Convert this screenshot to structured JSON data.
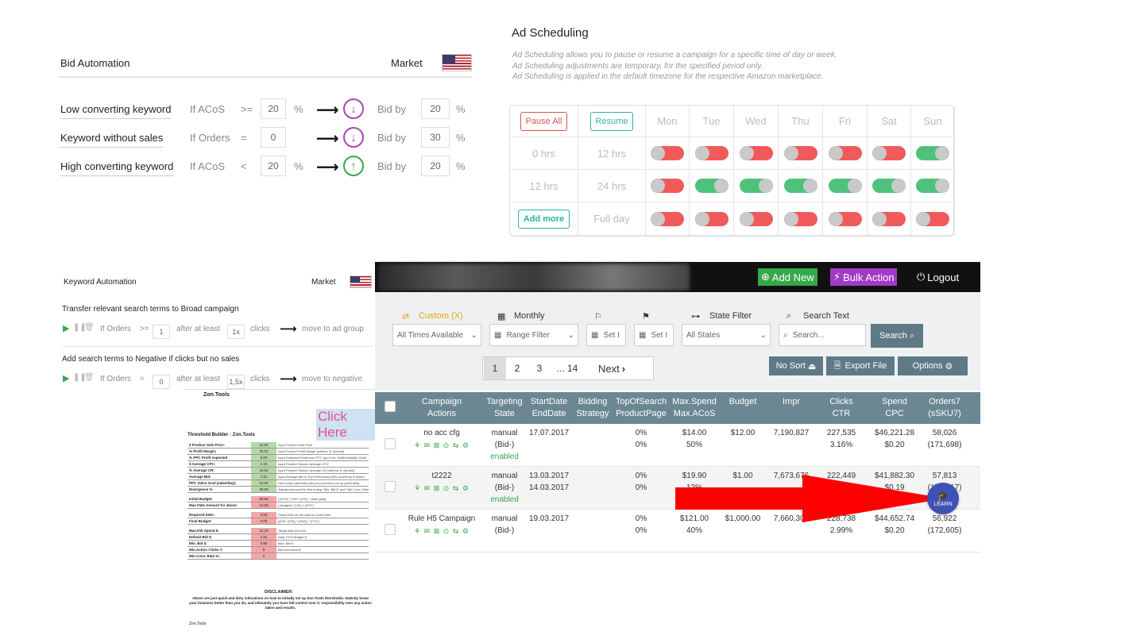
{
  "bid_automation": {
    "title": "Bid Automation",
    "market_label": "Market",
    "rules": [
      {
        "name": "Low converting keyword",
        "cond": "If ACoS",
        "op": ">=",
        "value": "20",
        "unit": "%",
        "direction": "down",
        "bid_label": "Bid by",
        "bid_value": "20",
        "bid_unit": "%"
      },
      {
        "name": "Keyword without sales",
        "cond": "If Orders",
        "op": "=",
        "value": "0",
        "unit": "",
        "direction": "down",
        "bid_label": "Bid by",
        "bid_value": "30",
        "bid_unit": "%"
      },
      {
        "name": "High converting keyword",
        "cond": "If ACoS",
        "op": "<",
        "value": "20",
        "unit": "%",
        "direction": "up",
        "bid_label": "Bid by",
        "bid_value": "20",
        "bid_unit": "%"
      }
    ]
  },
  "ad_scheduling": {
    "title": "Ad Scheduling",
    "desc": [
      "Ad Scheduling allows you to pause or resume a campaign for a specific time of day or week.",
      "Ad Scheduling adjustments are temporary, for the specified period only.",
      "Ad Scheduling is applied in the default timezone for the respective Amazon marketplace."
    ],
    "pause_all": "Pause All",
    "resume": "Resume",
    "add_more": "Add more",
    "days": [
      "Mon",
      "Tue",
      "Wed",
      "Thu",
      "Fri",
      "Sat",
      "Sun"
    ],
    "rows": [
      {
        "pause": "0 hrs",
        "resume": "12 hrs",
        "toggles": [
          false,
          false,
          false,
          false,
          false,
          false,
          true
        ]
      },
      {
        "pause": "12 hrs",
        "resume": "24 hrs",
        "toggles": [
          false,
          true,
          true,
          true,
          true,
          true,
          true
        ]
      },
      {
        "pause": "",
        "resume": "Full day",
        "toggles": [
          false,
          false,
          false,
          false,
          false,
          false,
          false
        ]
      }
    ]
  },
  "keyword_automation": {
    "title": "Keyword Automation",
    "market_label": "Market",
    "rules": [
      {
        "text": "Transfer relevant search terms to Broad campaign",
        "cond": "If Orders",
        "op": ">=",
        "value": "1",
        "after": "after at least",
        "clicks_value": "1x",
        "clicks": "clicks",
        "action": "move to ad group"
      },
      {
        "text": "Add search terms to Negative if clicks but no sales",
        "cond": "If Orders",
        "op": "=",
        "value": "0",
        "after": "after at least",
        "clicks_value": "1,5x",
        "clicks": "clicks",
        "action": "move to negative"
      }
    ]
  },
  "sheet": {
    "logo": "Zon.Tools",
    "click_here": "Click Here",
    "title": "Threshold Builder : Zon.Tools",
    "rows": [
      {
        "label": "$ Product Sale Price:",
        "value": "24.00",
        "color": "g",
        "hint": "Input Product Sale Price"
      },
      {
        "label": "% Profit Margin:",
        "value": "30.00",
        "color": "g",
        "hint": "Input Product Profit Margin (without % Symbol)"
      },
      {
        "label": "% PPC Profit expected",
        "value": "5.00",
        "color": "g",
        "hint": "Input Expected Profit from PPC (put 0 for Traffic/Visibility Goal)"
      },
      {
        "label": "$ Average CPC:",
        "value": "1.15",
        "color": "g",
        "hint": "Input Product Historic Average CPC"
      },
      {
        "label": "% Average CR:",
        "value": "16.62",
        "color": "g",
        "hint": "Input Product Historic Average CR (without % Symbol)"
      },
      {
        "label": "Average Bid:",
        "value": "1.51",
        "color": "g",
        "hint": "Input Average Bid or Top Performing KWs (sorted by $ Sales)"
      },
      {
        "label": "PPC Sales Goal (sales/day):",
        "value": "13.00",
        "color": "g",
        "hint": "How many sales/day was your previous set up generating"
      },
      {
        "label": "Divergence %",
        "value": "25.00",
        "color": "g",
        "hint": "Adjustment used for fine tuning \"Min. Bid $\" and \"Min Conv. Rate%\""
      },
      {
        "label": "Initial Budget:",
        "value": "90.50",
        "color": "r",
        "hint": "[ [CPC] * [100 / [CR] ] * [sale goal]"
      },
      {
        "label": "Max KWs Amount for above:",
        "value": "13.00",
        "color": "r",
        "hint": "[ [budget] * [CR] ] / [CPC]"
      },
      {
        "label": "Required KWs:",
        "value": "0.00",
        "color": "r",
        "hint": "Paste KWs on the right to count them"
      },
      {
        "label": "Final Budget:",
        "value": "0.00",
        "color": "r",
        "hint": "[[100 / [CR] ] * [KW] ] * [CPC]"
      },
      {
        "label": "Max.KW Spend $:",
        "value": "12.19",
        "color": "r",
        "hint": "Target Max.ACoS%:"
      },
      {
        "label": "Default Bid $:",
        "value": "1.51",
        "color": "r",
        "hint": "Daily PGN Budget $:"
      },
      {
        "label": "Min. Bid $:",
        "value": "0.86",
        "color": "r",
        "hint": "Max. Bid $:"
      },
      {
        "label": "Min.Action Clicks #:",
        "value": "8",
        "color": "r",
        "hint": "Bid Increment $:"
      },
      {
        "label": "Min.Conv. Rate %:",
        "value": "0",
        "color": "r",
        "hint": ""
      }
    ],
    "disclaimer_title": "DISCLAIMER:",
    "disclaimer": "Above are just quick and dirty indications on how to initially set up Zon.Tools thresholds. Nobody know your business better than you do, and ultimately you have full control over it. responsibility over any action taken and results.",
    "footer": "Zon.Tools"
  },
  "manager": {
    "add_new": "Add New",
    "bulk_action": "Bulk Action",
    "logout": "Logout",
    "filters": {
      "custom": "Custom (X)",
      "monthly": "Monthly",
      "state_filter": "State Filter",
      "search_text": "Search Text",
      "all_times": "All Times Available",
      "range_filter": "Range Filter",
      "set1": "Set I",
      "set2": "Set I",
      "all_states": "All States",
      "search_placeholder": "Search...",
      "search_btn": "Search"
    },
    "pager": {
      "p1": "1",
      "p2": "2",
      "p3": "3",
      "ellipsis": "... 14",
      "next": "Next"
    },
    "no_sort": "No Sort",
    "export": "Export File",
    "options": "Options",
    "columns": [
      [
        "Campaign",
        "Actions"
      ],
      [
        "Targeting",
        "State"
      ],
      [
        "StartDate",
        "EndDate"
      ],
      [
        "Bidding",
        "Strategy"
      ],
      [
        "TopOfSearch",
        "ProductPage"
      ],
      [
        "Max.Spend",
        "Max.ACoS"
      ],
      [
        "Budget",
        ""
      ],
      [
        "Impr",
        ""
      ],
      [
        "Clicks",
        "CTR"
      ],
      [
        "Spend",
        "CPC"
      ],
      [
        "Orders7",
        "(sSKU7)"
      ]
    ],
    "rows": [
      {
        "name": "no acc cfg",
        "targeting": "manual",
        "bid": "(Bid-)",
        "status": "enabled",
        "start": "17.07.2017",
        "end": "",
        "tos": "0%",
        "pp": "0%",
        "maxspend": "$14.00",
        "maxacos": "50%",
        "budget": "$12.00",
        "impr": "7,190,827",
        "clicks": "227,535",
        "ctr": "3.16%",
        "spend": "$46,221.28",
        "cpc": "$0.20",
        "orders": "58,026",
        "ssku": "(171,698)"
      },
      {
        "name": "t2222",
        "targeting": "manual",
        "bid": "(Bid-)",
        "status": "enabled",
        "start": "13.03.2017",
        "end": "14.03.2017",
        "tos": "0%",
        "pp": "0%",
        "maxspend": "$19.90",
        "maxacos": "12%",
        "budget": "$1.00",
        "impr": "7,673,676",
        "clicks": "222,449",
        "ctr": "",
        "spend": "$41,882.30",
        "cpc": "$0.19",
        "orders": "57,813",
        "ssku": "(171,917)"
      },
      {
        "name": "Rule H5 Campaign",
        "targeting": "manual",
        "bid": "(Bid-)",
        "status": "",
        "start": "19.03.2017",
        "end": "",
        "tos": "0%",
        "pp": "0%",
        "maxspend": "$121.00",
        "maxacos": "40%",
        "budget": "$1,000.00",
        "impr": "7,660,304",
        "clicks": "228,738",
        "ctr": "2.99%",
        "spend": "$44,652.74",
        "cpc": "$0.20",
        "orders": "56,922",
        "ssku": "(172,605)"
      }
    ],
    "learn": "LEARN"
  },
  "colors": {
    "accent_green": "#4ec27c",
    "accent_red": "#f05a5a",
    "table_header": "#6b8793",
    "arrow_red": "#ff0000",
    "learn_blue": "#3f51b5"
  }
}
